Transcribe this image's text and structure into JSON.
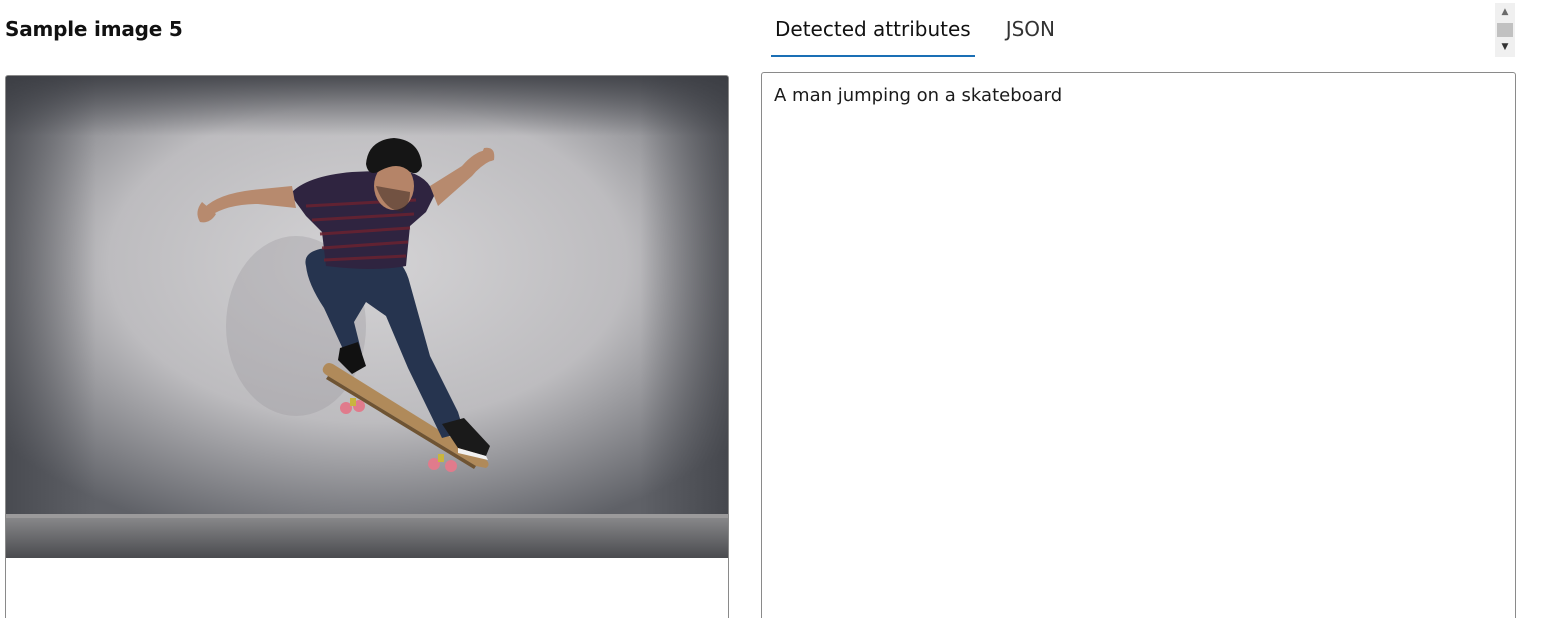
{
  "left_panel": {
    "title": "Sample image 5"
  },
  "tabs": [
    {
      "label": "Detected attributes",
      "active": true
    },
    {
      "label": "JSON",
      "active": false
    }
  ],
  "scrollbar": {
    "up_icon": "triangle-up",
    "down_icon": "triangle-down"
  },
  "result": {
    "caption": "A man jumping on a skateboard"
  },
  "colors": {
    "tab_accent": "#1a6fb5",
    "border": "#8a8a8a"
  }
}
